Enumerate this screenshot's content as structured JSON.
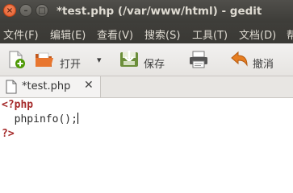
{
  "window": {
    "title": "*test.php (/var/www/html) - gedit",
    "close_glyph": "×",
    "minimize_glyph": "–",
    "maximize_glyph": "□"
  },
  "menu": {
    "items": [
      "文件(F)",
      "编辑(E)",
      "查看(V)",
      "搜索(S)",
      "工具(T)",
      "文档(D)",
      "帮"
    ]
  },
  "toolbar": {
    "open_label": "打开",
    "save_label": "保存",
    "undo_label": "撤消",
    "dropdown_glyph": "▾"
  },
  "tab": {
    "label": "*test.php",
    "close_glyph": "✕"
  },
  "editor": {
    "lines": [
      "<?php",
      "  phpinfo();",
      "?>"
    ]
  },
  "colors": {
    "php_tag": "#a52a2a",
    "titlebar": "#3d3c38",
    "close_button": "#e0582a"
  }
}
